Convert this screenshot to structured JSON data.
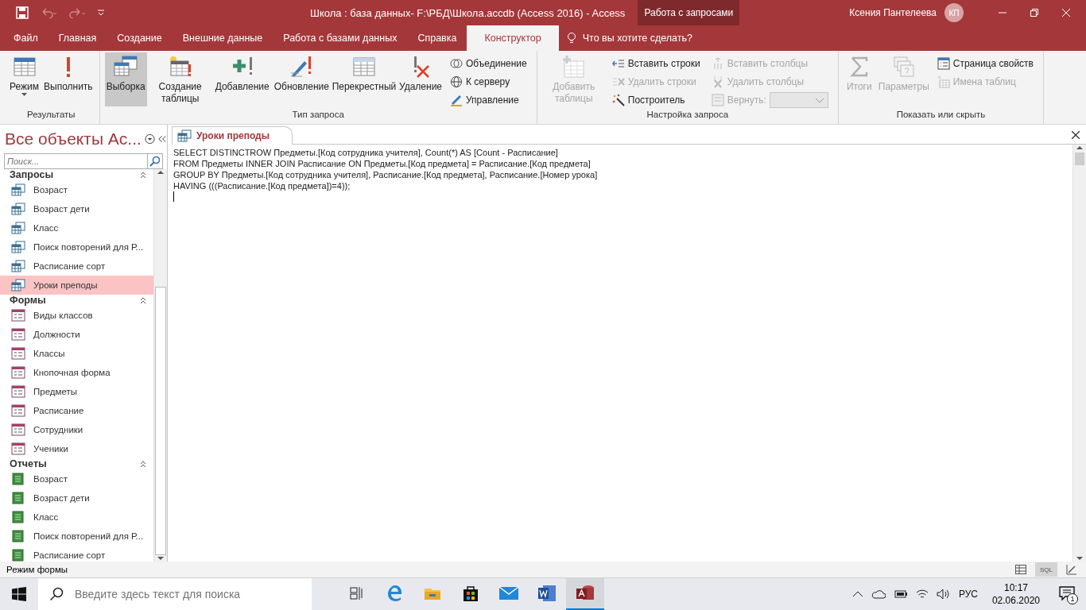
{
  "title_bar": {
    "title": "Школа : база данных- F:\\РБД\\Школа.accdb (Access 2016)  -  Access",
    "context_tab": "Работа с запросами",
    "user": "Ксения Пантелеева",
    "initials": "КП"
  },
  "ribbon_tabs": [
    {
      "label": "Файл",
      "selected": false
    },
    {
      "label": "Главная",
      "selected": false
    },
    {
      "label": "Создание",
      "selected": false
    },
    {
      "label": "Внешние данные",
      "selected": false
    },
    {
      "label": "Работа с базами данных",
      "selected": false
    },
    {
      "label": "Справка",
      "selected": false
    },
    {
      "label": "Конструктор",
      "selected": true
    }
  ],
  "tell_me": "Что вы хотите сделать?",
  "ribbon_groups": [
    {
      "label": "Результаты",
      "large": [
        {
          "label": "Режим",
          "selected": false,
          "disabled": false,
          "dropdown": true
        },
        {
          "label": "Выполнить",
          "selected": false,
          "disabled": false,
          "dropdown": false
        }
      ]
    },
    {
      "label": "Тип запроса",
      "large": [
        {
          "label": "Выборка",
          "selected": true,
          "disabled": false,
          "dropdown": false
        },
        {
          "label": "Создание таблицы",
          "selected": false,
          "disabled": false,
          "dropdown": false
        },
        {
          "label": "Добавление",
          "selected": false,
          "disabled": false,
          "dropdown": false
        },
        {
          "label": "Обновление",
          "selected": false,
          "disabled": false,
          "dropdown": false
        },
        {
          "label": "Перекрестный",
          "selected": false,
          "disabled": false,
          "dropdown": false
        },
        {
          "label": "Удаление",
          "selected": false,
          "disabled": false,
          "dropdown": false
        }
      ],
      "small_columns": [
        [
          {
            "label": "Объединение",
            "kind": "button",
            "disabled": false
          },
          {
            "label": "К серверу",
            "kind": "button",
            "disabled": false
          },
          {
            "label": "Управление",
            "kind": "button",
            "disabled": false
          }
        ]
      ]
    },
    {
      "label": "Настройка запроса",
      "large": [
        {
          "label": "Добавить таблицы",
          "selected": false,
          "disabled": true,
          "dropdown": false
        }
      ],
      "small_columns": [
        [
          {
            "label": "Вставить строки",
            "kind": "button",
            "disabled": false
          },
          {
            "label": "Удалить строки",
            "kind": "button",
            "disabled": true
          },
          {
            "label": "Построитель",
            "kind": "button",
            "disabled": false
          }
        ],
        [
          {
            "label": "Вставить столбцы",
            "kind": "button",
            "disabled": true
          },
          {
            "label": "Удалить столбцы",
            "kind": "button",
            "disabled": true
          },
          {
            "label": "Вернуть:",
            "kind": "combo",
            "disabled": true
          }
        ]
      ]
    },
    {
      "label": "Показать или скрыть",
      "large": [
        {
          "label": "Итоги",
          "selected": false,
          "disabled": true,
          "dropdown": false
        },
        {
          "label": "Параметры",
          "selected": false,
          "disabled": true,
          "dropdown": false
        }
      ],
      "small_columns": [
        [
          {
            "label": "Страница свойств",
            "kind": "button",
            "disabled": false
          },
          {
            "label": "Имена таблиц",
            "kind": "button",
            "disabled": true
          }
        ]
      ]
    }
  ],
  "nav": {
    "title": "Все объекты Ac...",
    "search_placeholder": "Поиск...",
    "sections": [
      {
        "title": "Запросы",
        "kind": "query",
        "items": [
          {
            "label": "Возраст",
            "selected": false
          },
          {
            "label": "Возраст дети",
            "selected": false
          },
          {
            "label": "Класс",
            "selected": false
          },
          {
            "label": "Поиск повторений для Р...",
            "selected": false
          },
          {
            "label": "Расписание сорт",
            "selected": false
          },
          {
            "label": "Уроки преподы",
            "selected": true
          }
        ]
      },
      {
        "title": "Формы",
        "kind": "form",
        "items": [
          {
            "label": "Виды классов",
            "selected": false
          },
          {
            "label": "Должности",
            "selected": false
          },
          {
            "label": "Классы",
            "selected": false
          },
          {
            "label": "Кнопочная форма",
            "selected": false
          },
          {
            "label": "Предметы",
            "selected": false
          },
          {
            "label": "Расписание",
            "selected": false
          },
          {
            "label": "Сотрудники",
            "selected": false
          },
          {
            "label": "Ученики",
            "selected": false
          }
        ]
      },
      {
        "title": "Отчеты",
        "kind": "report",
        "items": [
          {
            "label": "Возраст",
            "selected": false
          },
          {
            "label": "Возраст дети",
            "selected": false
          },
          {
            "label": "Класс",
            "selected": false
          },
          {
            "label": "Поиск повторений для Р...",
            "selected": false
          },
          {
            "label": "Расписание сорт",
            "selected": false
          }
        ]
      }
    ]
  },
  "document": {
    "tab": "Уроки преподы",
    "sql_lines": [
      "SELECT DISTINCTROW Предметы.[Код сотрудника учителя], Count(*) AS [Count - Расписание]",
      "FROM Предметы INNER JOIN Расписание ON Предметы.[Код предмета] = Расписание.[Код предмета]",
      "GROUP BY Предметы.[Код сотрудника учителя], Расписание.[Код предмета], Расписание.[Номер урока]",
      "HAVING (((Расписание.[Код предмета])=4));"
    ]
  },
  "status_bar": {
    "text": "Режим формы",
    "views": [
      {
        "kind": "datasheet",
        "selected": false
      },
      {
        "kind": "sql",
        "label": "SQL",
        "selected": true
      },
      {
        "kind": "design",
        "selected": false
      }
    ]
  },
  "taskbar": {
    "search_placeholder": "Введите здесь текст для поиска",
    "apps": [
      {
        "kind": "taskview",
        "selected": false
      },
      {
        "kind": "edge",
        "selected": false
      },
      {
        "kind": "explorer",
        "selected": false
      },
      {
        "kind": "store",
        "selected": false
      },
      {
        "kind": "mail",
        "selected": false
      },
      {
        "kind": "word",
        "selected": false
      },
      {
        "kind": "access",
        "selected": true
      }
    ],
    "language": "РУС",
    "time": "10:17",
    "date": "02.06.2020",
    "notifications": "1"
  }
}
